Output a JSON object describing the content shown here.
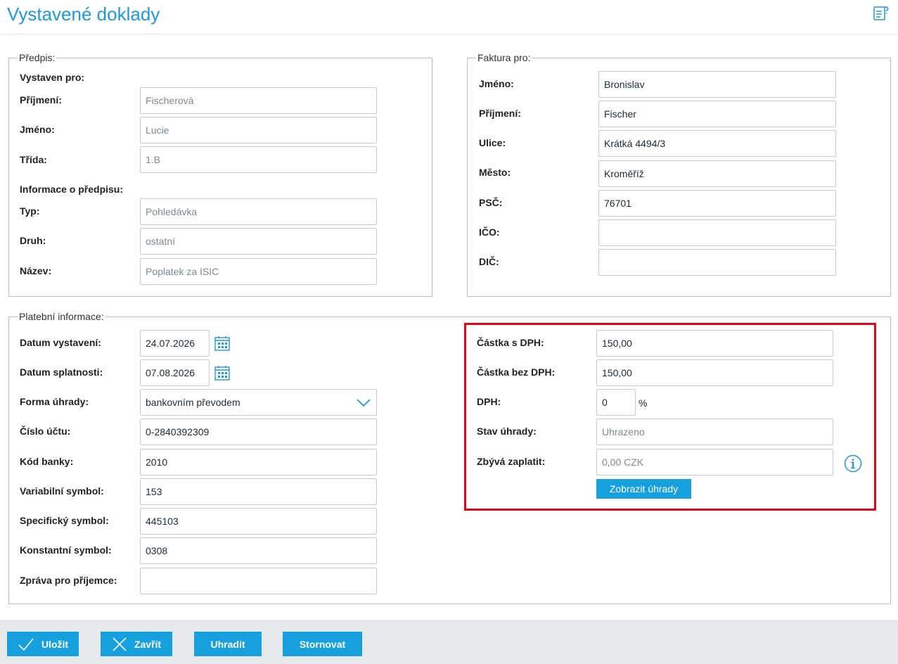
{
  "header": {
    "title": "Vystavené doklady",
    "help_icon": "help-document-icon"
  },
  "predpis": {
    "legend": "Předpis:",
    "vystaven_pro": "Vystaven pro:",
    "prijmeni_label": "Příjmení:",
    "prijmeni_value": "Fischerová",
    "jmeno_label": "Jméno:",
    "jmeno_value": "Lucie",
    "trida_label": "Třída:",
    "trida_value": "1.B",
    "info_heading": "Informace o předpisu:",
    "typ_label": "Typ:",
    "typ_value": "Pohledávka",
    "druh_label": "Druh:",
    "druh_value": "ostatní",
    "nazev_label": "Název:",
    "nazev_value": "Poplatek za ISIC"
  },
  "faktura": {
    "legend": "Faktura pro:",
    "jmeno_label": "Jméno:",
    "jmeno_value": "Bronislav",
    "prijmeni_label": "Příjmení:",
    "prijmeni_value": "Fischer",
    "ulice_label": "Ulice:",
    "ulice_value": "Krátká 4494/3",
    "mesto_label": "Město:",
    "mesto_value": "Kroměříž",
    "psc_label": "PSČ:",
    "psc_value": "76701",
    "ico_label": "IČO:",
    "ico_value": "",
    "dic_label": "DIČ:",
    "dic_value": ""
  },
  "platebni": {
    "legend": "Platební informace:",
    "datum_vystaveni_label": "Datum vystavení:",
    "datum_vystaveni_value": "24.07.2026",
    "datum_splatnosti_label": "Datum splatnosti:",
    "datum_splatnosti_value": "07.08.2026",
    "forma_uhrady_label": "Forma úhrady:",
    "forma_uhrady_value": "bankovním převodem",
    "cislo_uctu_label": "Číslo účtu:",
    "cislo_uctu_value": "0-2840392309",
    "kod_banky_label": "Kód banky:",
    "kod_banky_value": "2010",
    "vs_label": "Variabilní symbol:",
    "vs_value": "153",
    "ss_label": "Specifický symbol:",
    "ss_value": "445103",
    "ks_label": "Konstantní symbol:",
    "ks_value": "0308",
    "zprava_label": "Zpráva pro příjemce:",
    "zprava_value": "",
    "castka_s_dph_label": "Částka s DPH:",
    "castka_s_dph_value": "150,00",
    "castka_bez_dph_label": "Částka bez DPH:",
    "castka_bez_dph_value": "150,00",
    "dph_label": "DPH:",
    "dph_value": "0",
    "dph_unit": "%",
    "stav_uhrady_label": "Stav úhrady:",
    "stav_uhrady_value": "Uhrazeno",
    "zbyva_label": "Zbývá zaplatit:",
    "zbyva_value": "0,00 CZK",
    "zobrazit_uhrady": "Zobrazit úhrady"
  },
  "footer": {
    "ulozit": "Uložit",
    "zavrit": "Zavřít",
    "uhradit": "Uhradit",
    "stornovat": "Stornovat"
  },
  "colors": {
    "accent": "#17a0de",
    "title": "#1e9ad6",
    "highlight": "#e30613",
    "footer_bg": "#e6eaed"
  }
}
